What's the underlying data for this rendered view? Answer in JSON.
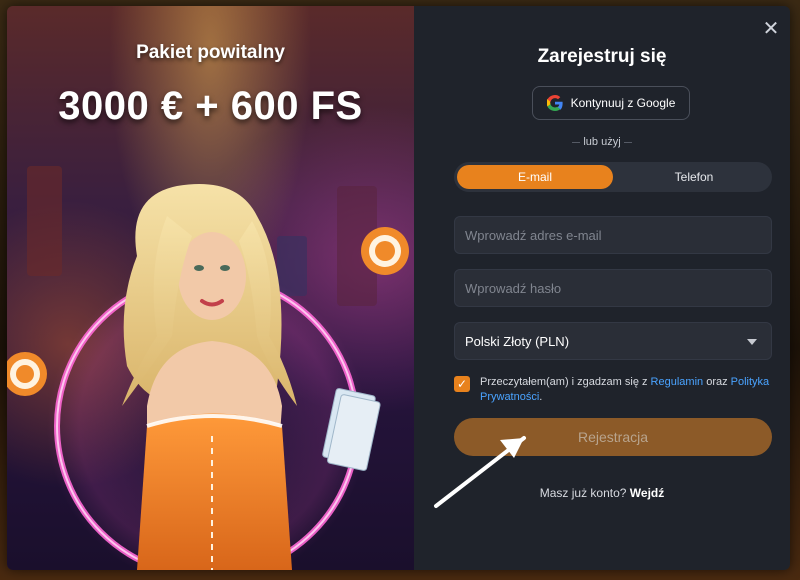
{
  "promo": {
    "title": "Pakiet powitalny",
    "bonus": "3000 € + 600 FS"
  },
  "form": {
    "title": "Zarejestruj się",
    "close_icon": "close-icon",
    "google_label": "Kontynuuj z Google",
    "or_text": "lub użyj",
    "tabs": [
      {
        "label": "E-mail",
        "active": true
      },
      {
        "label": "Telefon",
        "active": false
      }
    ],
    "email_placeholder": "Wprowadź adres e-mail",
    "password_placeholder": "Wprowadź hasło",
    "currency": "Polski Złoty (PLN)",
    "terms": {
      "prefix": "Przeczytałem(am) i zgadzam się z ",
      "link1": "Regulamin",
      "middle": " oraz ",
      "link2": "Polityka Prywatności",
      "suffix": ".",
      "checked": true
    },
    "register_label": "Rejestracja",
    "login_prompt": "Masz już konto?",
    "login_link": "Wejdź"
  },
  "colors": {
    "accent": "#e8821d",
    "panel_bg": "#1f232b",
    "link": "#4aa3ff"
  }
}
